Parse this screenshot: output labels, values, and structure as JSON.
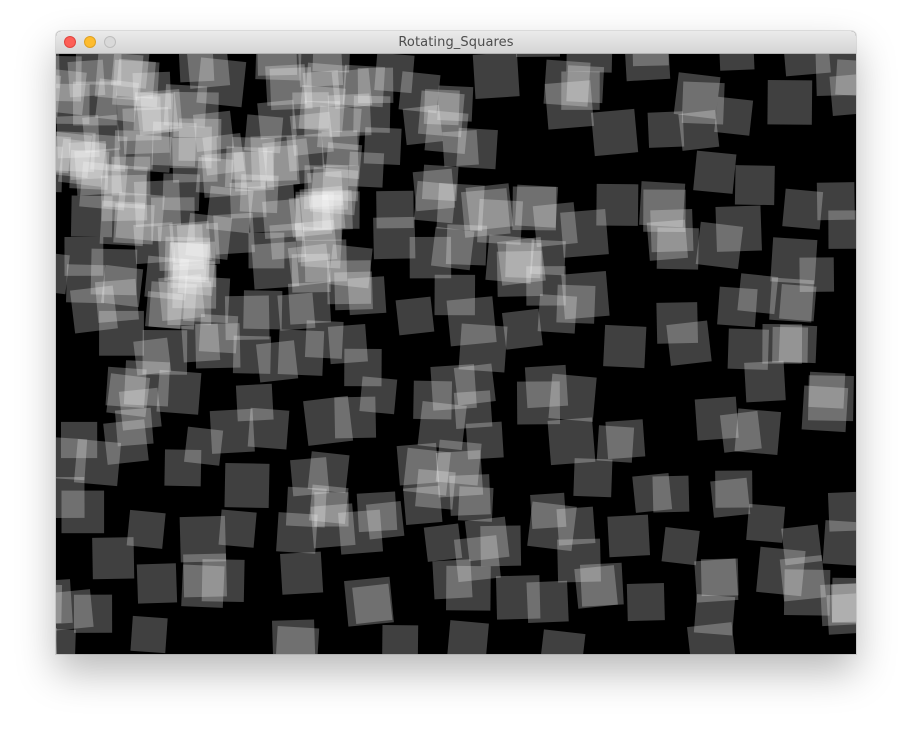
{
  "window": {
    "title": "Rotating_Squares",
    "controls": [
      {
        "name": "close-button",
        "icon": "close-circle-icon",
        "color": "#fd5f57"
      },
      {
        "name": "minimize-button",
        "icon": "minimize-circle-icon",
        "color": "#febc2e"
      },
      {
        "name": "zoom-button",
        "icon": "zoom-circle-icon",
        "color": "#d9d9d9"
      }
    ]
  },
  "canvas": {
    "background": "#000000",
    "square_color": "#ffffff",
    "square_opacity": 0.25
  }
}
